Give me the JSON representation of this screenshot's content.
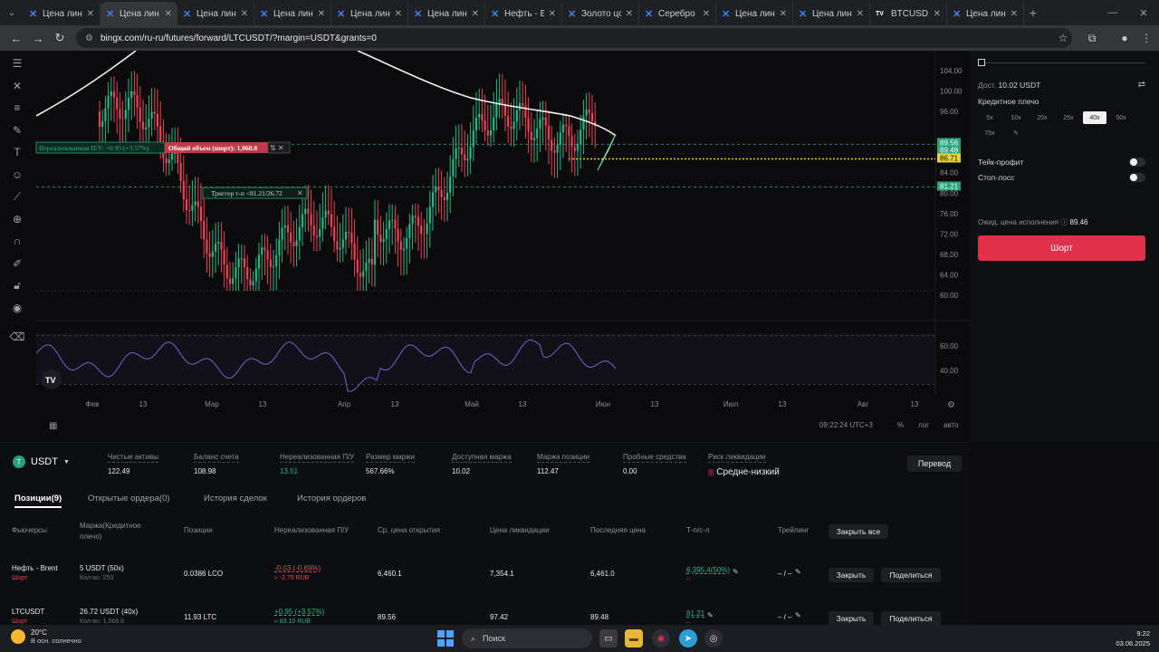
{
  "browser": {
    "tabs": [
      {
        "label": "Цена лин",
        "active": false,
        "icon": "bingx-icon"
      },
      {
        "label": "Цена лин",
        "active": true,
        "icon": "bingx-icon"
      },
      {
        "label": "Цена лин",
        "active": false,
        "icon": "bingx-icon"
      },
      {
        "label": "Цена лин",
        "active": false,
        "icon": "bingx-icon"
      },
      {
        "label": "Цена лин",
        "active": false,
        "icon": "bingx-icon"
      },
      {
        "label": "Цена лин",
        "active": false,
        "icon": "bingx-icon"
      },
      {
        "label": "Нефть - В",
        "active": false,
        "icon": "bingx-icon"
      },
      {
        "label": "Золото цс",
        "active": false,
        "icon": "bingx-icon"
      },
      {
        "label": "Серебро",
        "active": false,
        "icon": "bingx-icon"
      },
      {
        "label": "Цена лин",
        "active": false,
        "icon": "bingx-icon"
      },
      {
        "label": "Цена лин",
        "active": false,
        "icon": "bingx-icon"
      },
      {
        "label": "BTCUSD",
        "active": false,
        "icon": "tradingview-icon"
      },
      {
        "label": "Цена лин",
        "active": false,
        "icon": "bingx-icon"
      }
    ],
    "url": "bingx.com/ru-ru/futures/forward/LTCUSDT/?margin=USDT&grants=0"
  },
  "chart": {
    "price_ticks": [
      "104.00",
      "100.00",
      "96.00",
      "89.56",
      "89.48",
      "86.71",
      "84.00",
      "81.21",
      "80.00",
      "76.00",
      "72.00",
      "68.00",
      "64.00",
      "60.00"
    ],
    "highlight_tags": [
      {
        "text": "89.56",
        "color": "#2aa57a"
      },
      {
        "text": "89.48",
        "color": "#2aa57a"
      },
      {
        "text": "86.71",
        "color": "#e8d535"
      },
      {
        "text": "81.21",
        "color": "#2aa57a"
      }
    ],
    "rsi_ticks": [
      "60.00",
      "40.00"
    ],
    "time_ticks": [
      "Фев",
      "13",
      "Мар",
      "13",
      "Апр",
      "13",
      "Май",
      "13",
      "Июн",
      "13",
      "Июл",
      "13",
      "Авг",
      "13"
    ],
    "position_label": "Нереализованная П/У: +0.95 (+3.57%)",
    "volume_label": "Общий объем (шорт): 1,068.8",
    "trigger_label": "Триггер т-п <81.21/26.72",
    "timestamp": "09:22:24 UTC+3",
    "scale_options": [
      "%",
      "лог",
      "авто"
    ]
  },
  "trade_panel": {
    "available_label": "Дост.",
    "available_value": "10.02 USDT",
    "leverage_label": "Кредитное плечо",
    "leverage_options": [
      "5x",
      "10x",
      "20x",
      "25x",
      "40x",
      "50x",
      "75x"
    ],
    "selected_leverage": "40x",
    "take_profit_label": "Тейк-профит",
    "stop_loss_label": "Стоп-лосс",
    "expected_price_label": "Ожид. цена исполнения",
    "expected_price_value": "89.46",
    "short_button": "Шорт"
  },
  "account": {
    "currency": "USDT",
    "stats": [
      {
        "label": "Чистые активы",
        "value": "122.49"
      },
      {
        "label": "Баланс счета",
        "value": "108.98"
      },
      {
        "label": "Нереализованная П/У",
        "value": "13.51",
        "color": "#26b883"
      },
      {
        "label": "Размер маржи",
        "value": "567.66%"
      },
      {
        "label": "Доступная маржа",
        "value": "10.02"
      },
      {
        "label": "Маржа позиции",
        "value": "112.47"
      },
      {
        "label": "Пробные средства",
        "value": "0.00"
      },
      {
        "label": "Риск ликвидации",
        "value": "Средне-низкий"
      }
    ],
    "transfer_button": "Перевод"
  },
  "bottom_tabs": [
    "Позиции(9)",
    "Открытые ордера(0)",
    "История сделок",
    "История ордеров"
  ],
  "table": {
    "headers": [
      "Фьючерсы",
      "Маржа(Кредитное плечо)",
      "Позиции",
      "Нереализованная П/У",
      "Ср. цена открытия",
      "Цена ликвидации",
      "Последняя цена",
      "Т-п/с-л",
      "Трейлинг"
    ],
    "close_all": "Закрыть все",
    "rows": [
      {
        "symbol": "Нефть - Brent",
        "side": "Шорт",
        "margin": "5 USDT (50x)",
        "qty_sub": "Кол-во: 250",
        "position": "0.0386 LCO",
        "pnl": "-0.03 (-0.69%)",
        "pnl_sub": "≈ -2.75 RUB",
        "open_price": "6,460.1",
        "liq_price": "7,354.1",
        "last_price": "6,461.0",
        "tpsl": "6,395.4(50%)",
        "tpsl_sub": "--",
        "trailing": "– / –",
        "close": "Закрыть",
        "share": "Поделиться"
      },
      {
        "symbol": "LTCUSDT",
        "side": "Шорт",
        "margin": "26.72 USDT (40x)",
        "qty_sub": "Кол-во: 1,068.8",
        "position": "11.93 LTC",
        "pnl": "+0.95 (+3.57%)",
        "pnl_sub": "≈ 83.10 RUB",
        "open_price": "89.56",
        "liq_price": "97.42",
        "last_price": "89.48",
        "tpsl": "81.21",
        "tpsl_sub": "--",
        "trailing": "– / –",
        "close": "Закрыть",
        "share": "Поделиться"
      }
    ]
  },
  "taskbar": {
    "temperature": "20°C",
    "weather_text": "В осн. солнечно",
    "search_placeholder": "Поиск",
    "time": "9:22",
    "date": "03.06.2025"
  }
}
